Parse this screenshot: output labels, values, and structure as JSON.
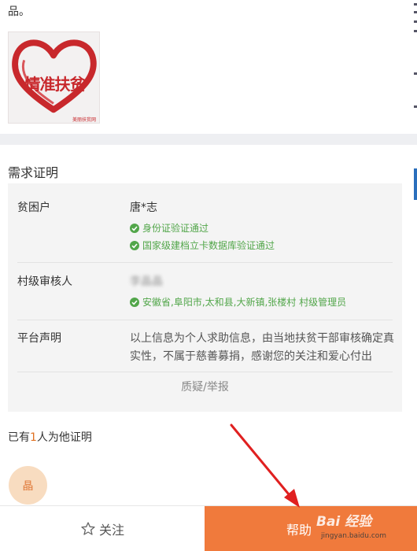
{
  "top_text": "品。",
  "logo": {
    "text": "情准扶贫",
    "sub": "美丽扶贫网"
  },
  "section_title": "需求证明",
  "card": {
    "rows": [
      {
        "label": "贫困户",
        "value": "唐*志",
        "verifications": [
          "身份证验证通过",
          "国家级建档立卡数据库验证通过"
        ]
      },
      {
        "label": "村级审核人",
        "value": "李晶晶",
        "verifications": [
          "安徽省,阜阳市,太和县,大新镇,张楼村 村级管理员"
        ]
      },
      {
        "label": "平台声明",
        "value": "以上信息为个人求助信息，由当地扶贫干部审核确定真实性，不属于慈善募捐，感谢您的关注和爱心付出"
      }
    ],
    "report_link": "质疑/举报"
  },
  "proof": {
    "prefix": "已有",
    "count": "1",
    "suffix": "人为他证明"
  },
  "avatar": {
    "char": "晶"
  },
  "bottom": {
    "follow_label": "关注",
    "help_label": "帮助"
  },
  "watermark": {
    "main": "Bai 经验",
    "sub": "jingyan.baidu.com"
  },
  "colors": {
    "accent": "#f07a3c",
    "verify_green": "#52a64a",
    "logo_red": "#c8282c",
    "annotation_arrow": "#e02020"
  }
}
